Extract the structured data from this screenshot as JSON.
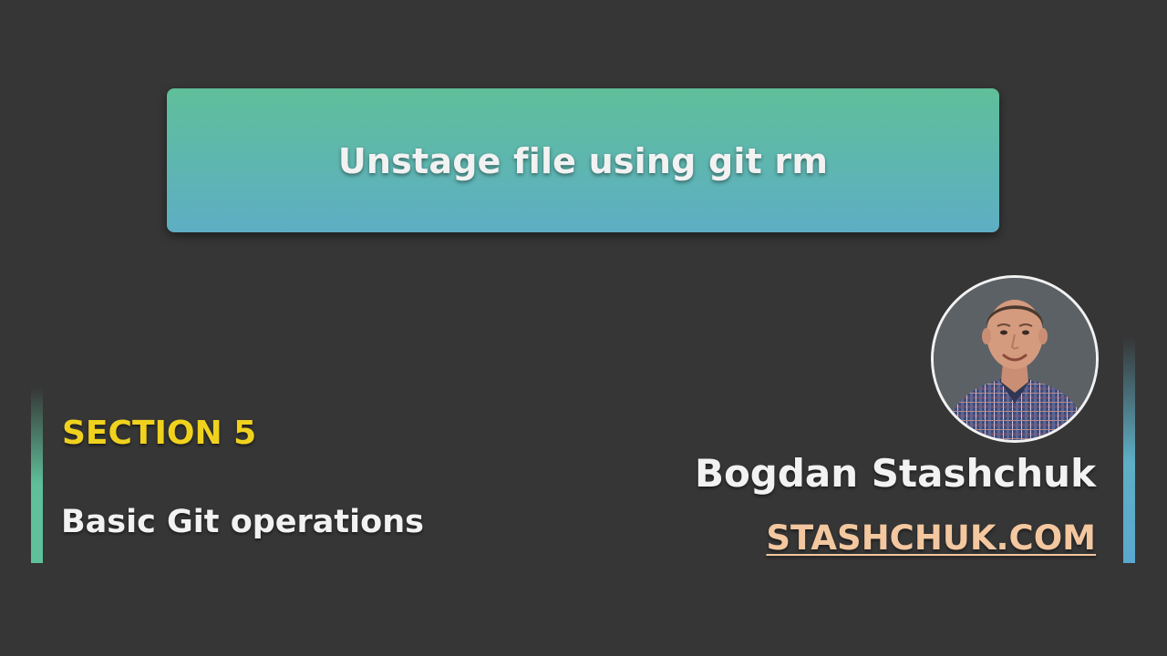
{
  "banner": {
    "title": "Unstage file using git rm"
  },
  "section": {
    "label": "SECTION 5",
    "subtitle": "Basic Git operations"
  },
  "author": {
    "name": "Bogdan Stashchuk",
    "website": "STASHCHUK.COM"
  },
  "colors": {
    "background": "#363636",
    "banner_top": "#5fbf9a",
    "banner_bottom": "#5eaec4",
    "section_label": "#f0d21e",
    "website": "#f3c79f",
    "text": "#f2f2f2"
  },
  "icons": {
    "avatar": "author-photo"
  }
}
